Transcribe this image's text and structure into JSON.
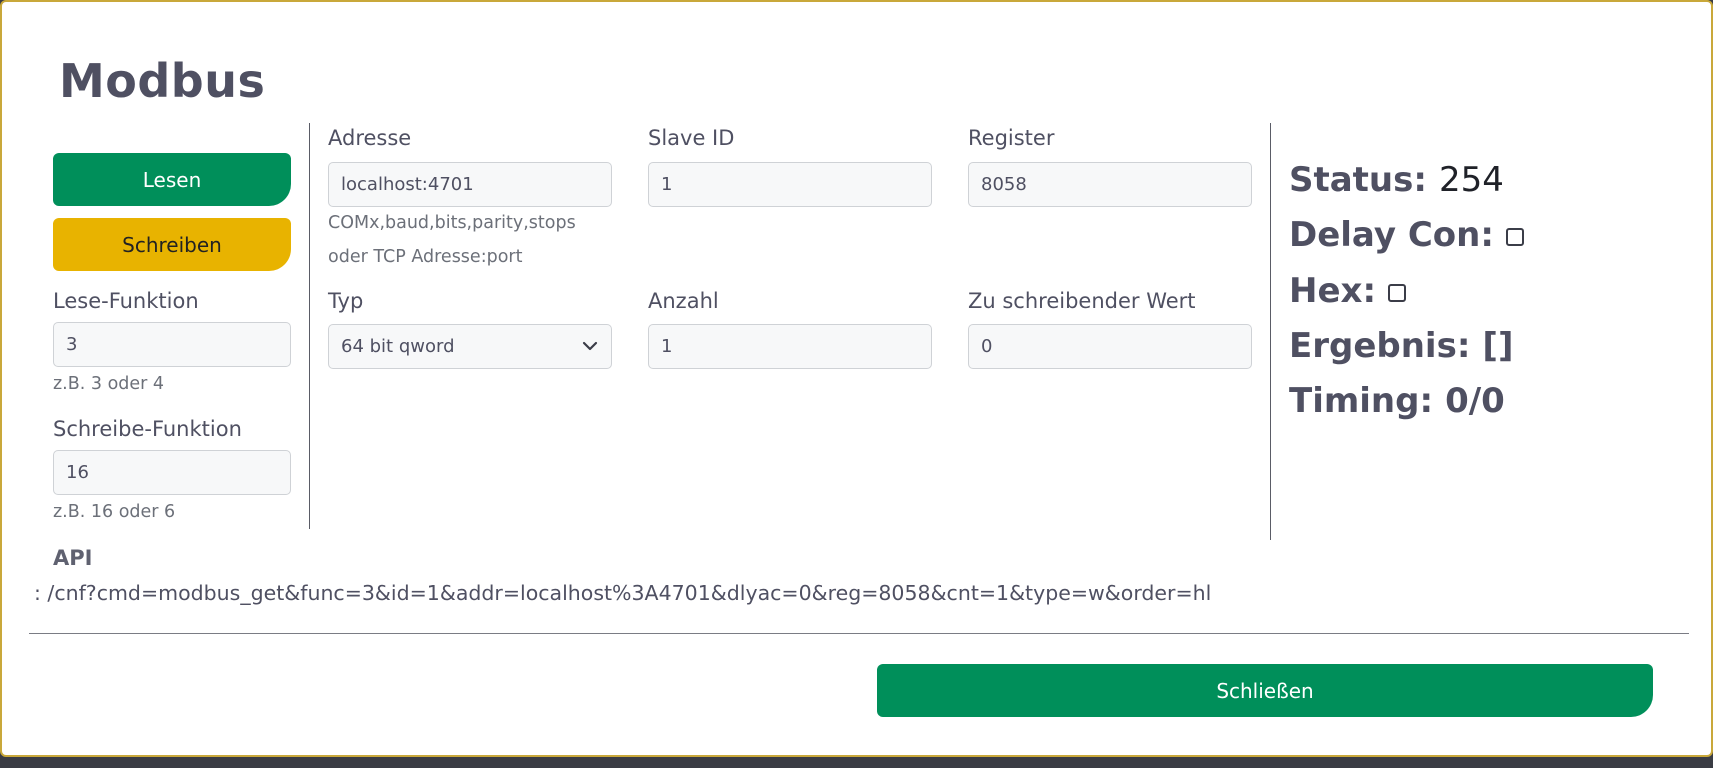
{
  "dialog": {
    "title": "Modbus"
  },
  "actions": {
    "read_label": "Lesen",
    "write_label": "Schreiben",
    "close_label": "Schließen"
  },
  "read_function": {
    "label": "Lese-Funktion",
    "value": "3",
    "help": "z.B. 3 oder 4"
  },
  "write_function": {
    "label": "Schreibe-Funktion",
    "value": "16",
    "help": "z.B. 16 oder 6"
  },
  "address": {
    "label": "Adresse",
    "value": "localhost:4701",
    "help_line1": "COMx,baud,bits,parity,stops",
    "help_line2": "oder TCP Adresse:port"
  },
  "slave_id": {
    "label": "Slave ID",
    "value": "1"
  },
  "register": {
    "label": "Register",
    "value": "8058"
  },
  "type": {
    "label": "Typ",
    "selected": "64 bit qword"
  },
  "count": {
    "label": "Anzahl",
    "value": "1"
  },
  "write_value": {
    "label": "Zu schreibender Wert",
    "value": "0"
  },
  "status": {
    "status_label": "Status:",
    "status_value": "254",
    "delay_label": "Delay Con:",
    "hex_label": "Hex:",
    "result_label": "Ergebnis:",
    "result_value": "[]",
    "timing_label": "Timing:",
    "timing_value": "0/0"
  },
  "api": {
    "title": "API",
    "url": ": /cnf?cmd=modbus_get&func=3&id=1&addr=localhost%3A4701&dlyac=0&reg=8058&cnt=1&type=w&order=hl"
  },
  "icons": {
    "select_chevron": "chevron-down-icon",
    "checkbox": "checkbox-icon"
  },
  "colors": {
    "primary": "#008f5a",
    "warning": "#e8b300",
    "text": "#4f5062"
  }
}
